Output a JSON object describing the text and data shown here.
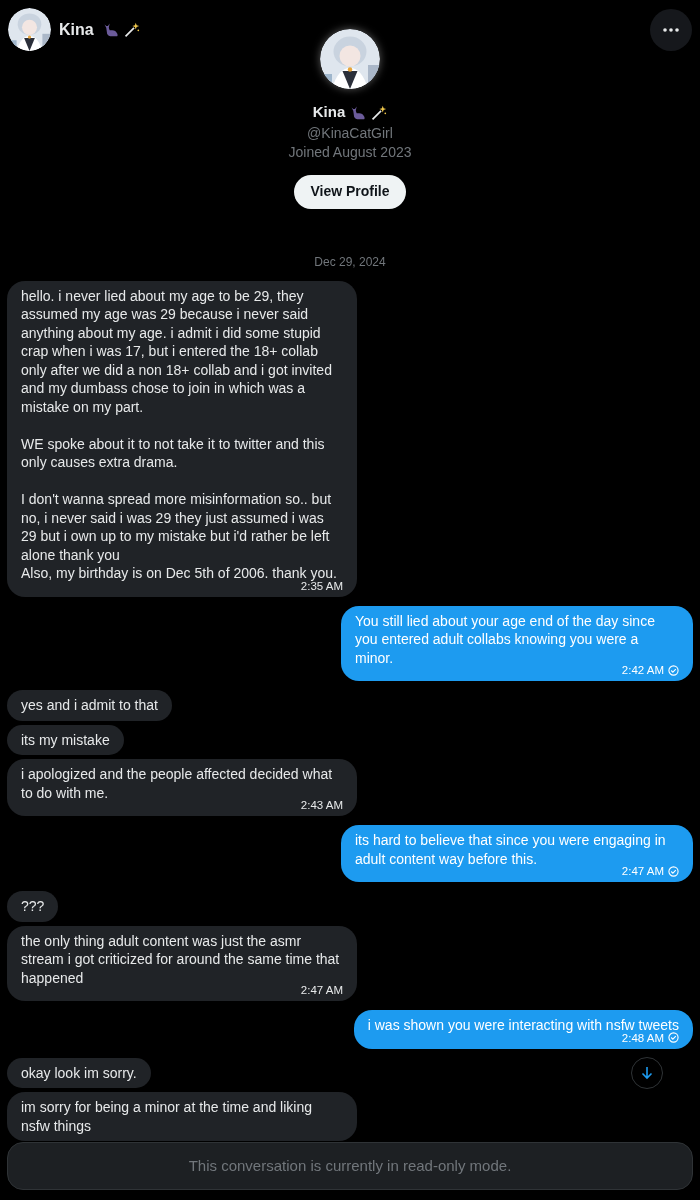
{
  "header": {
    "name": "Kina"
  },
  "profile": {
    "name": "Kina",
    "handle": "@KinaCatGirl",
    "joined": "Joined August 2023",
    "button": "View Profile"
  },
  "date": "Dec 29, 2024",
  "messages": [
    {
      "kind": "received",
      "paragraphs": [
        "hello. i never lied about my age to be 29, they assumed my age was 29 because i never said anything about my age. i admit i did some stupid crap when i was 17, but i entered the 18+ collab only after we did a non 18+ collab and i got invited and my dumbass chose to join in which was a mistake on my part.",
        "WE spoke about it to not take it to twitter and this only causes extra drama.",
        "I don't wanna spread more misinformation so.. but no, i never said i was 29 they just assumed i was 29 but i own up to my mistake but i'd rather be left alone thank you\nAlso, my birthday is on Dec 5th of 2006. thank you."
      ],
      "time": "2:35 AM"
    },
    {
      "kind": "sent",
      "paragraphs": [
        "You still lied about your age end of the day since you entered adult collabs knowing you were a minor."
      ],
      "time": "2:42 AM"
    },
    {
      "kind": "received",
      "paragraphs": [
        "yes and i admit to that"
      ]
    },
    {
      "kind": "received",
      "paragraphs": [
        "its my mistake"
      ]
    },
    {
      "kind": "received",
      "paragraphs": [
        "i apologized and the people affected decided what to do with me."
      ],
      "time": "2:43 AM"
    },
    {
      "kind": "sent",
      "paragraphs": [
        "its hard to believe that since you were engaging in adult content way before this."
      ],
      "time": "2:47 AM"
    },
    {
      "kind": "received",
      "paragraphs": [
        "???"
      ]
    },
    {
      "kind": "received",
      "paragraphs": [
        "the only thing adult content was just the asmr stream i got criticized for around the same time that happened"
      ],
      "time": "2:47 AM"
    },
    {
      "kind": "sent",
      "paragraphs": [
        "i was shown you were interacting with nsfw tweets"
      ],
      "time": "2:48 AM"
    },
    {
      "kind": "received",
      "paragraphs": [
        "okay look im sorry."
      ]
    },
    {
      "kind": "received",
      "paragraphs": [
        "im sorry for being a minor at the time and liking nsfw things"
      ]
    }
  ],
  "notice": "This conversation is currently in read-only mode."
}
